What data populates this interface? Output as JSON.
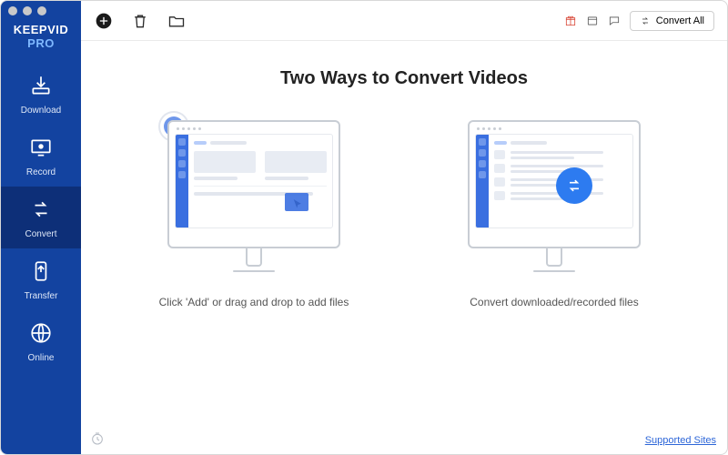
{
  "app": {
    "logo_main": "KEEPVID",
    "logo_suffix": "PRO"
  },
  "sidebar": {
    "items": [
      {
        "label": "Download",
        "icon": "download-icon"
      },
      {
        "label": "Record",
        "icon": "record-icon"
      },
      {
        "label": "Convert",
        "icon": "convert-icon"
      },
      {
        "label": "Transfer",
        "icon": "transfer-icon"
      },
      {
        "label": "Online",
        "icon": "globe-icon"
      }
    ],
    "active_index": 2
  },
  "toolbar": {
    "convert_all_label": "Convert All"
  },
  "content": {
    "headline": "Two Ways to Convert Videos",
    "method1_caption": "Click 'Add' or drag and drop to add files",
    "method2_caption": "Convert downloaded/recorded files"
  },
  "footer": {
    "supported_sites_label": "Supported Sites"
  }
}
